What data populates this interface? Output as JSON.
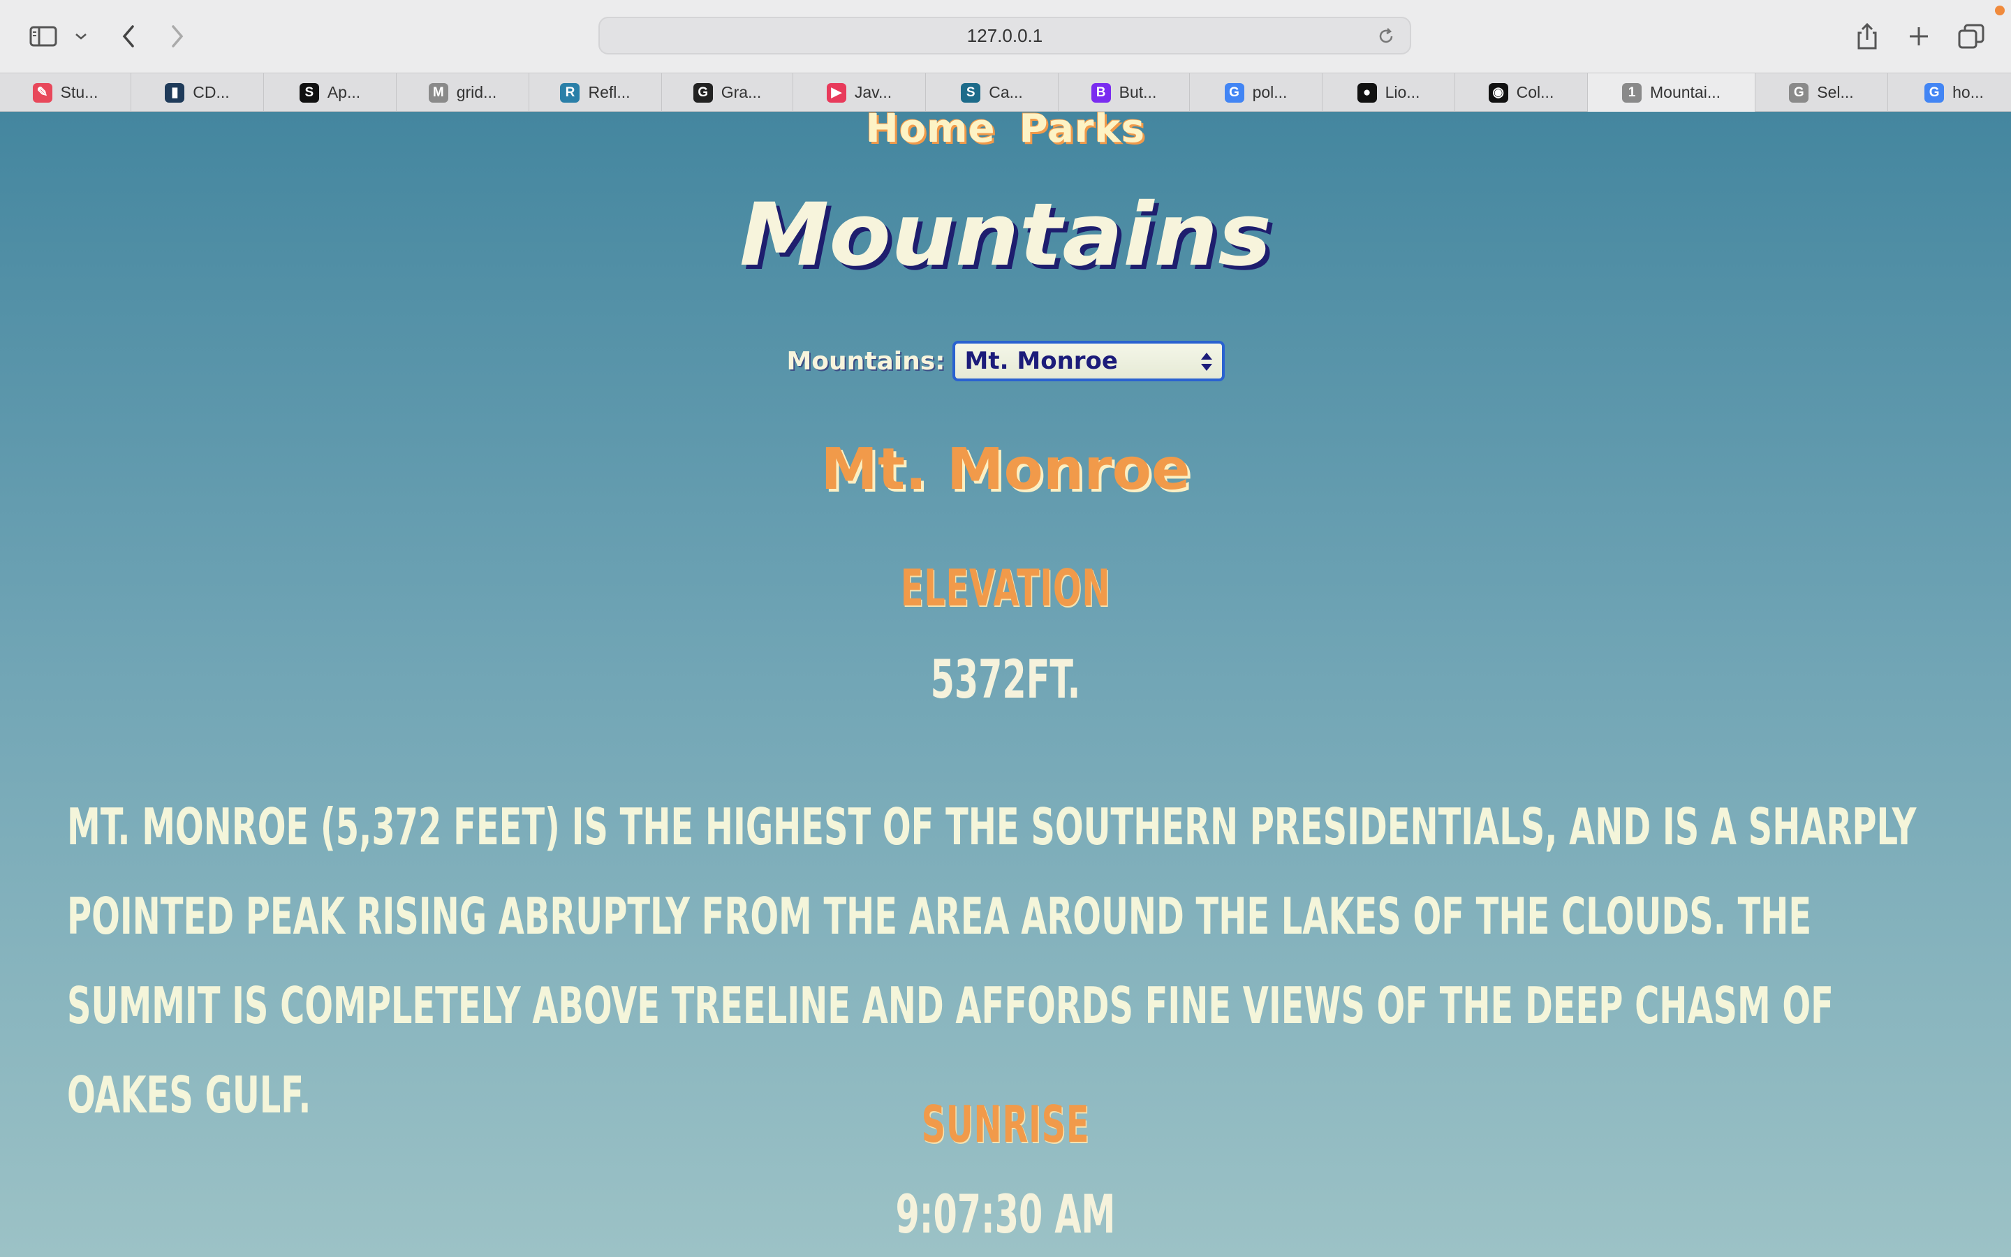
{
  "browser": {
    "url": "127.0.0.1",
    "tabs": [
      {
        "label": "Stu...",
        "icon": "chat-bubble-icon",
        "color": "#e8485b"
      },
      {
        "label": "CD...",
        "icon": "cd-logo-icon",
        "color": "#1f3b5a"
      },
      {
        "label": "Ap...",
        "icon": "s-logo-icon",
        "color": "#111111"
      },
      {
        "label": "grid...",
        "icon": "m-letter-icon",
        "color": "#8a8a8a"
      },
      {
        "label": "Refl...",
        "icon": "r-logo-icon",
        "color": "#2a7fa8"
      },
      {
        "label": "Gra...",
        "icon": "g-letter-icon",
        "color": "#222222"
      },
      {
        "label": "Jav...",
        "icon": "play-logo-icon",
        "color": "#e83a5b"
      },
      {
        "label": "Ca...",
        "icon": "s-circle-icon",
        "color": "#1d6b8a"
      },
      {
        "label": "But...",
        "icon": "b-logo-icon",
        "color": "#7a2cf0"
      },
      {
        "label": "pol...",
        "icon": "google-icon",
        "color": "#4285f4"
      },
      {
        "label": "Lio...",
        "icon": "github-icon",
        "color": "#111111"
      },
      {
        "label": "Col...",
        "icon": "col-logo-icon",
        "color": "#111111"
      },
      {
        "label": "Mountai...",
        "icon": "number-1-icon",
        "color": "#8a8a8a",
        "active": true
      },
      {
        "label": "Sel...",
        "icon": "g-letter-gray-icon",
        "color": "#8a8a8a"
      },
      {
        "label": "ho...",
        "icon": "google-icon",
        "color": "#4285f4"
      }
    ]
  },
  "nav": {
    "home": "Home",
    "parks": "Parks"
  },
  "page_title": "Mountains",
  "selector": {
    "label": "Mountains:",
    "selected": "Mt. Monroe"
  },
  "mountain": {
    "name": "Mt. Monroe",
    "elevation_label": "ELEVATION",
    "elevation_value": "5372FT.",
    "description": "MT. MONROE (5,372 FEET) IS THE HIGHEST OF THE SOUTHERN PRESIDENTIALS, AND IS A SHARPLY POINTED PEAK RISING ABRUPTLY FROM THE AREA AROUND THE LAKES OF THE CLOUDS. THE SUMMIT IS COMPLETELY ABOVE TREELINE AND AFFORDS FINE VIEWS OF THE DEEP CHASM OF OAKES GULF.",
    "sunrise_label": "SUNRISE",
    "sunrise_value": "9:07:30 AM"
  },
  "colors": {
    "accent_orange": "#f19a4a",
    "cream_text": "#f5f2dc",
    "title_shadow": "#1e1e6e",
    "select_border": "#2a62d0"
  }
}
